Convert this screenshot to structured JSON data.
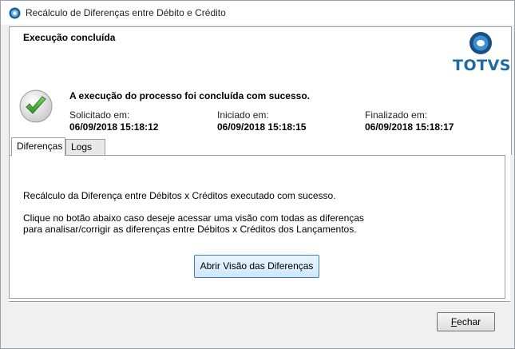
{
  "window": {
    "title": "Recálculo de Diferenças entre Débito e Crédito",
    "icon": "totvs-app-icon"
  },
  "header": {
    "title": "Execução concluída",
    "logo_text": "TOTVS"
  },
  "status": {
    "message": "A execução do processo foi concluída com sucesso.",
    "requested_label": "Solicitado em:",
    "requested_value": "06/09/2018 15:18:12",
    "started_label": "Iniciado em:",
    "started_value": "06/09/2018 15:18:15",
    "finished_label": "Finalizado em:",
    "finished_value": "06/09/2018 15:18:17",
    "icon": "success-check-icon"
  },
  "tabs": [
    {
      "label": "Diferenças",
      "active": true
    },
    {
      "label": "Logs",
      "active": false
    }
  ],
  "content": {
    "message1": "Recálculo da Diferença entre Débitos x Créditos executado com sucesso.",
    "message2_line1": "Clique no botão abaixo caso deseje acessar uma visão com todas as diferenças",
    "message2_line2": "para analisar/corrigir as diferenças entre Débitos x Créditos dos Lançamentos.",
    "view_button": "Abrir Visão das Diferenças"
  },
  "footer": {
    "close_mnemonic": "F",
    "close_rest": "echar"
  },
  "colors": {
    "brand_blue": "#1d6aa6",
    "check_green": "#3aa33a",
    "primary_button_border": "#3c7fb1"
  }
}
